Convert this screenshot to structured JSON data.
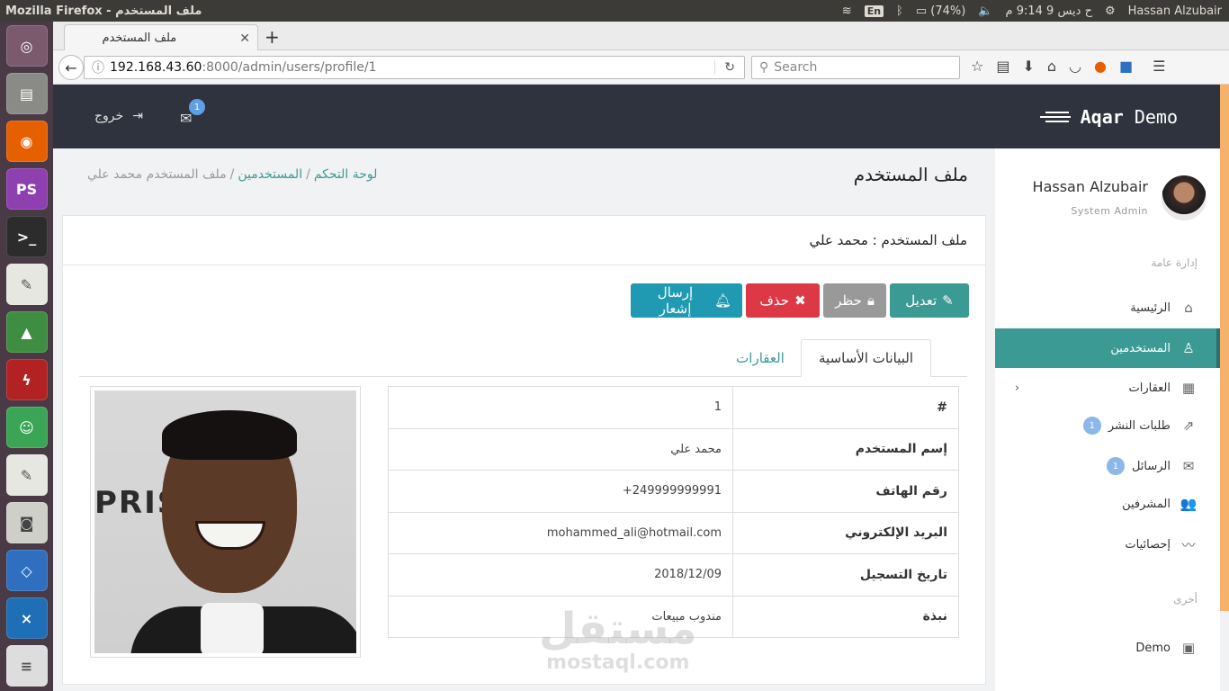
{
  "os": {
    "window_title": "Mozilla Firefox - ملف المستخدم",
    "lang": "En",
    "battery": "(74%)",
    "clock": "ح ديس 9  9:14 م",
    "user": "Hassan Alzubair"
  },
  "launcher": {
    "apps": [
      "ubuntu-icon",
      "files-icon",
      "firefox-icon",
      "phpstorm-icon",
      "terminal-icon",
      "text-editor-icon",
      "android-studio-icon",
      "filezilla-icon",
      "game-icon",
      "text-editor-icon",
      "camera-icon",
      "virtualbox-icon",
      "vscode-icon",
      "workspace-icon"
    ],
    "phpstorm_label": "PS"
  },
  "browser": {
    "tab_title": "ملف المستخدم",
    "url_host": "192.168.43.60",
    "url_path": ":8000/admin/users/profile/1",
    "search_placeholder": "Search"
  },
  "header": {
    "brand_bold": "Aqar",
    "brand_rest": " Demo",
    "logout_label": "خروج",
    "mail_badge": "1"
  },
  "sidebar": {
    "user_name": "Hassan Alzubair",
    "user_role": "System Admin",
    "section_general": "إدارة عامة",
    "items": [
      {
        "label": "الرئيسية",
        "icon": "home-icon"
      },
      {
        "label": "المستخدمين",
        "icon": "user-icon",
        "active": true
      },
      {
        "label": "العقارات",
        "icon": "building-icon"
      },
      {
        "label": "طلبات النشر",
        "icon": "share-icon",
        "badge": "1"
      },
      {
        "label": "الرسائل",
        "icon": "envelope-icon",
        "badge": "1"
      },
      {
        "label": "المشرفين",
        "icon": "users-icon"
      },
      {
        "label": "إحصائيات",
        "icon": "chart-line-icon"
      }
    ],
    "section_other": "أخرى",
    "other_items": [
      {
        "label": "Demo",
        "icon": "image-icon"
      }
    ]
  },
  "main": {
    "page_title": "ملف المستخدم",
    "breadcrumb": {
      "dashboard": "لوحة التحكم",
      "users": "المستخدمين",
      "current": "ملف المستخدم محمد علي",
      "sep": "/"
    },
    "card_title": "ملف المستخدم : محمد علي",
    "actions": {
      "edit": "تعديل",
      "ban": "حظر",
      "delete": "حذف",
      "notify": "إرسال إشعار"
    },
    "tabs": {
      "basic": "البيانات الأساسية",
      "properties": "العقارات"
    },
    "fields": [
      {
        "label": "#",
        "value": "1"
      },
      {
        "label": "إسم المستخدم",
        "value": "محمد علي"
      },
      {
        "label": "رقم الهاتف",
        "value": "+249999999991"
      },
      {
        "label": "البريد الإلكتروني",
        "value": "mohammed_ali@hotmail.com"
      },
      {
        "label": "تاريخ التسجيل",
        "value": "2018/12/09"
      },
      {
        "label": "نبذة",
        "value": "مندوب مبيعات"
      }
    ],
    "photo_backdrop_text": "PRIS"
  },
  "watermark": {
    "arabic": "مستقل",
    "latin": "mostaql.com"
  },
  "colors": {
    "accent": "#3c9a95",
    "danger": "#dd3845",
    "info": "#1f9ab2",
    "muted": "#999999",
    "header_bg": "#2f333e"
  }
}
